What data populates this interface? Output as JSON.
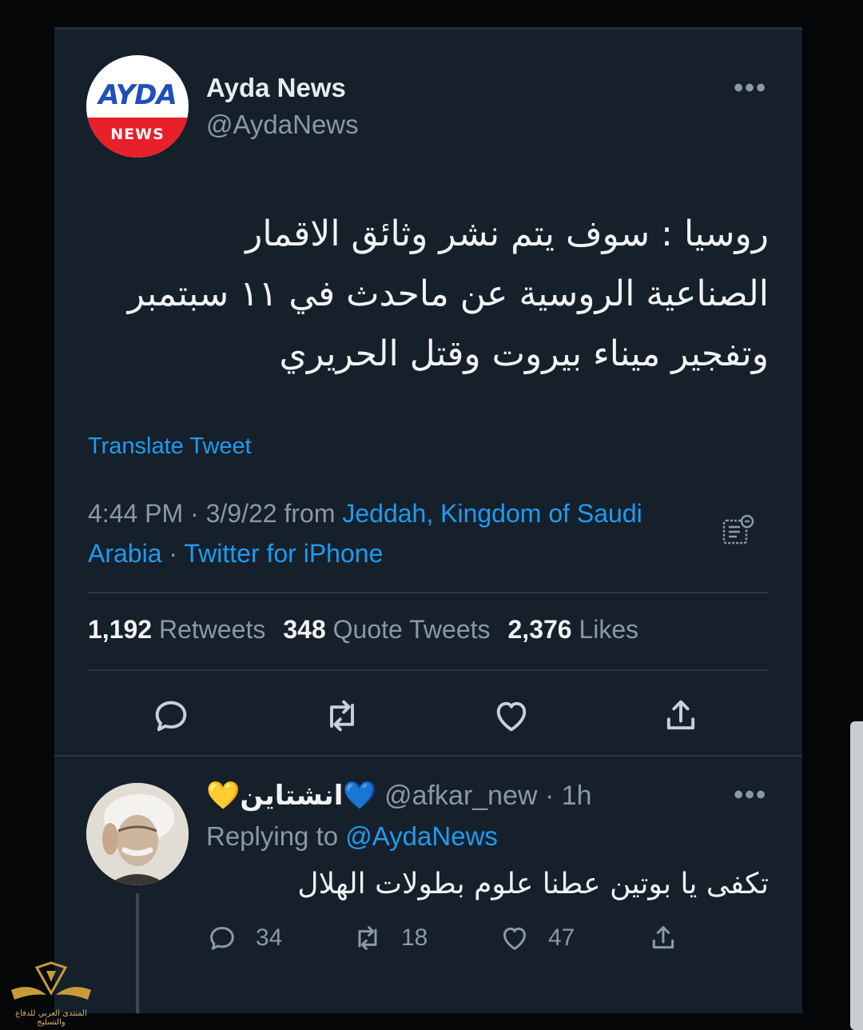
{
  "tweet": {
    "author": {
      "display_name": "Ayda News",
      "handle": "@AydaNews",
      "avatar_logo": {
        "brand": "AYDA",
        "sub": "NEWS"
      }
    },
    "more_icon": "more-horizontal-icon",
    "text_lines": [
      "روسيا : سوف يتم  نشر  وثائق الاقمار",
      "الصناعية الروسية عن ماحدث في  ١١ سبتمبر",
      "وتفجير ميناء بيروت وقتل الحريري"
    ],
    "translate_label": "Translate Tweet",
    "meta": {
      "time_date": "4:44 PM · 3/9/22",
      "from_word": " from ",
      "location": "Jeddah, Kingdom of Saudi Arabia",
      "separator": " · ",
      "source": "Twitter for iPhone"
    },
    "stats": {
      "retweets_count": "1,192",
      "retweets_label": "Retweets",
      "quotes_count": "348",
      "quotes_label": "Quote Tweets",
      "likes_count": "2,376",
      "likes_label": "Likes"
    },
    "actions": [
      "reply-icon",
      "retweet-icon",
      "like-icon",
      "share-icon"
    ]
  },
  "reply": {
    "display_name": "💛انشتاين💙",
    "handle_time": "@afkar_new · 1h",
    "replying_prefix": "Replying to ",
    "replying_handle": "@AydaNews",
    "text": "تكفى يا بوتين عطنا علوم بطولات الهلال",
    "counts": {
      "replies": "34",
      "retweets": "18",
      "likes": "47"
    }
  },
  "watermark": {
    "text": "المنتدى العربي للدفاع والتسليح"
  },
  "colors": {
    "background": "#15202b",
    "text": "#f1f3f5",
    "secondary": "#8b98a5",
    "accent": "#1d9bf0"
  }
}
